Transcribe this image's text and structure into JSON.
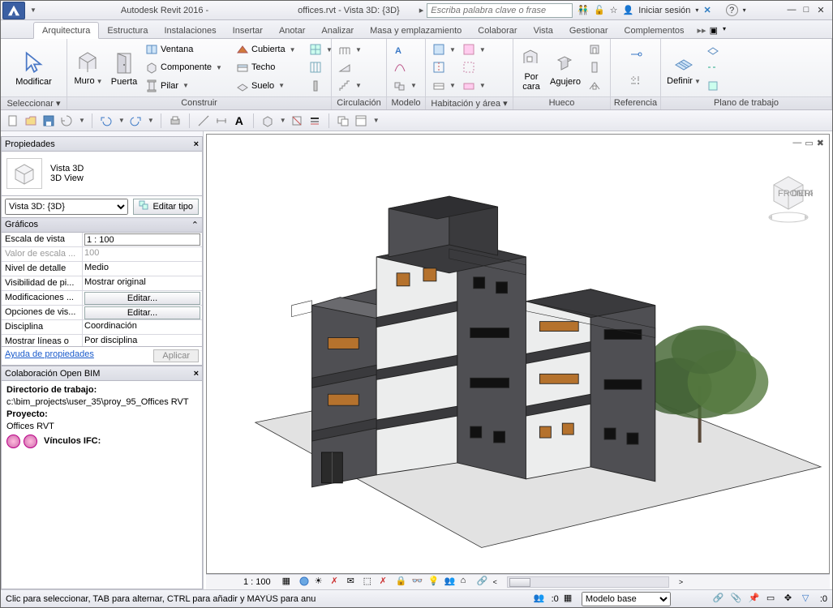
{
  "titlebar": {
    "app": "Autodesk Revit 2016 -",
    "doc": "offices.rvt - Vista 3D: {3D}",
    "search_placeholder": "Escriba palabra clave o frase",
    "signin": "Iniciar sesión"
  },
  "ribbon_tabs": [
    "Arquitectura",
    "Estructura",
    "Instalaciones",
    "Insertar",
    "Anotar",
    "Analizar",
    "Masa y emplazamiento",
    "Colaborar",
    "Vista",
    "Gestionar",
    "Complementos"
  ],
  "ribbon_active": 0,
  "ribbon": {
    "seleccionar": {
      "label": "Seleccionar ▾",
      "modificar": "Modificar"
    },
    "construir": {
      "label": "Construir",
      "muro": "Muro",
      "puerta": "Puerta",
      "ventana": "Ventana",
      "componente": "Componente",
      "pilar": "Pilar",
      "cubierta": "Cubierta",
      "techo": "Techo",
      "suelo": "Suelo"
    },
    "circulacion": {
      "label": "Circulación"
    },
    "modelo": {
      "label": "Modelo"
    },
    "habitacion": {
      "label": "Habitación y área ▾"
    },
    "hueco": {
      "label": "Hueco",
      "porcara": "Por\ncara",
      "agujero": "Agujero"
    },
    "referencia": {
      "label": "Referencia"
    },
    "plano": {
      "label": "Plano de trabajo",
      "definir": "Definir"
    }
  },
  "properties": {
    "title": "Propiedades",
    "type_line1": "Vista 3D",
    "type_line2": "3D View",
    "selector": "Vista 3D: {3D}",
    "edit_type": "Editar tipo",
    "group": "Gráficos",
    "rows": [
      {
        "k": "Escala de vista",
        "v": "1 : 100",
        "kind": "input"
      },
      {
        "k": "Valor de escala   ...",
        "v": "100",
        "kind": "dim"
      },
      {
        "k": "Nivel de detalle",
        "v": "Medio",
        "kind": "text"
      },
      {
        "k": "Visibilidad de pi...",
        "v": "Mostrar original",
        "kind": "text"
      },
      {
        "k": "Modificaciones ...",
        "v": "Editar...",
        "kind": "btn"
      },
      {
        "k": "Opciones de vis...",
        "v": "Editar...",
        "kind": "btn"
      },
      {
        "k": "Disciplina",
        "v": "Coordinación",
        "kind": "text"
      },
      {
        "k": "Mostrar líneas o",
        "v": "Por disciplina",
        "kind": "textcut"
      }
    ],
    "help": "Ayuda de propiedades",
    "apply": "Aplicar"
  },
  "collab": {
    "title": "Colaboración Open BIM",
    "dir_lbl": "Directorio de trabajo:",
    "dir_val": "c:\\bim_projects\\user_35\\proy_95_Offices RVT",
    "proj_lbl": "Proyecto:",
    "proj_val": "Offices RVT",
    "links_lbl": "Vínculos IFC:"
  },
  "vcb": {
    "scale": "1 : 100"
  },
  "statusbar": {
    "msg": "Clic para seleccionar, TAB para alternar, CTRL para añadir y MAYÚS para anu",
    "zero": ":0",
    "model_base": "Modelo base"
  }
}
